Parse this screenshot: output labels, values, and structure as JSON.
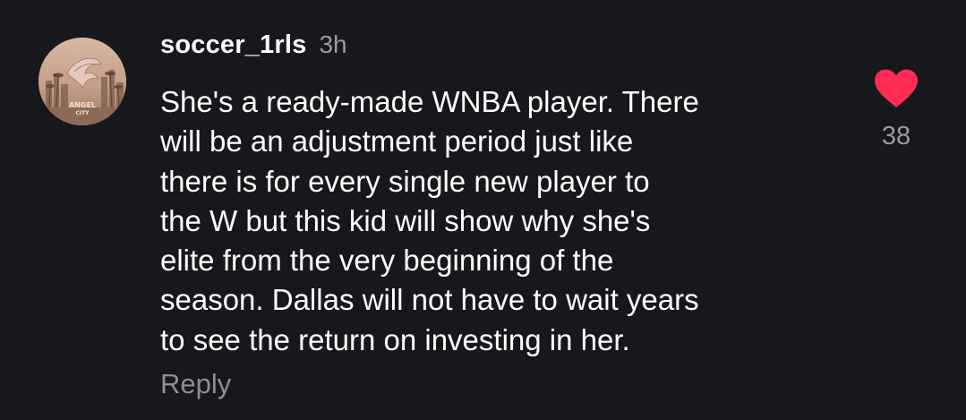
{
  "comment": {
    "avatar": {
      "logo_text_top": "ANGEL",
      "logo_text_bottom": "CITY"
    },
    "username": "soccer_1rls",
    "timestamp": "3h",
    "body_lines": [
      "She's a ready-made WNBA player. There",
      "will be an adjustment period just like",
      "there is for every single new player to",
      "the W but this kid will show why she's",
      "elite from the very beginning of the",
      "season. Dallas will not have to wait years",
      "to see the return on investing in her."
    ],
    "reply_label": "Reply",
    "like": {
      "icon": "heart-icon",
      "liked": true,
      "color": "#fe2c55",
      "count": "38"
    }
  }
}
